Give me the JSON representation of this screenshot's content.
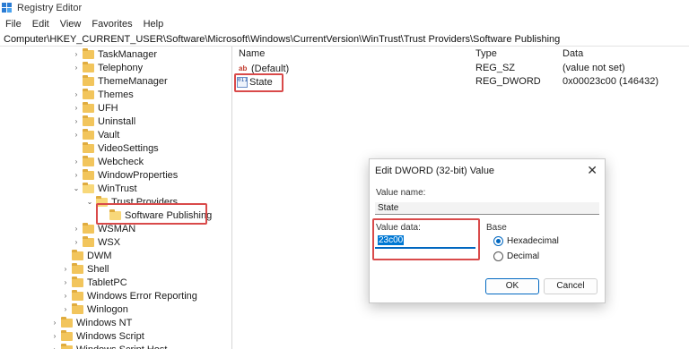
{
  "window": {
    "title": "Registry Editor"
  },
  "menu": [
    "File",
    "Edit",
    "View",
    "Favorites",
    "Help"
  ],
  "address": "Computer\\HKEY_CURRENT_USER\\Software\\Microsoft\\Windows\\CurrentVersion\\WinTrust\\Trust Providers\\Software Publishing",
  "tree": [
    {
      "label": "TaskManager",
      "expander": "›",
      "selected": false
    },
    {
      "label": "Telephony",
      "expander": "›",
      "selected": false
    },
    {
      "label": "ThemeManager",
      "expander": "",
      "selected": false
    },
    {
      "label": "Themes",
      "expander": "›",
      "selected": false
    },
    {
      "label": "UFH",
      "expander": "›",
      "selected": false
    },
    {
      "label": "Uninstall",
      "expander": "›",
      "selected": false
    },
    {
      "label": "Vault",
      "expander": "›",
      "selected": false
    },
    {
      "label": "VideoSettings",
      "expander": "",
      "selected": false
    },
    {
      "label": "Webcheck",
      "expander": "›",
      "selected": false
    },
    {
      "label": "WindowProperties",
      "expander": "›",
      "selected": false
    },
    {
      "label": "WinTrust",
      "expander": "⌄",
      "selected": false
    },
    {
      "label": "Trust Providers",
      "expander": "⌄",
      "selected": false
    },
    {
      "label": "Software Publishing",
      "expander": "",
      "selected": true
    },
    {
      "label": "WSMAN",
      "expander": "›",
      "selected": false
    },
    {
      "label": "WSX",
      "expander": "›",
      "selected": false
    },
    {
      "label": "DWM",
      "expander": "",
      "selected": false
    },
    {
      "label": "Shell",
      "expander": "›",
      "selected": false
    },
    {
      "label": "TabletPC",
      "expander": "›",
      "selected": false
    },
    {
      "label": "Windows Error Reporting",
      "expander": "›",
      "selected": false
    },
    {
      "label": "Winlogon",
      "expander": "›",
      "selected": false
    },
    {
      "label": "Windows NT",
      "expander": "›",
      "selected": false
    },
    {
      "label": "Windows Script",
      "expander": "›",
      "selected": false
    },
    {
      "label": "Windows Script Host",
      "expander": "›",
      "selected": false
    }
  ],
  "list": {
    "headers": {
      "name": "Name",
      "type": "Type",
      "data": "Data"
    },
    "rows": [
      {
        "icon": "string-value-icon",
        "icon_text": "ab",
        "name": "(Default)",
        "type": "REG_SZ",
        "data": "(value not set)"
      },
      {
        "icon": "binary-value-icon",
        "icon_text": "011 110",
        "name": "State",
        "type": "REG_DWORD",
        "data": "0x00023c00 (146432)"
      }
    ]
  },
  "dialog": {
    "title": "Edit DWORD (32-bit) Value",
    "close_glyph": "✕",
    "value_name_label": "Value name:",
    "value_name": "State",
    "value_data_label": "Value data:",
    "value_data": "23c00",
    "base_label": "Base",
    "base_options": [
      "Hexadecimal",
      "Decimal"
    ],
    "base_selected": "Hexadecimal",
    "ok_label": "OK",
    "cancel_label": "Cancel"
  },
  "colors": {
    "highlight_border": "#d94a4a",
    "accent": "#0067c0",
    "folder": "#f2c55c"
  }
}
